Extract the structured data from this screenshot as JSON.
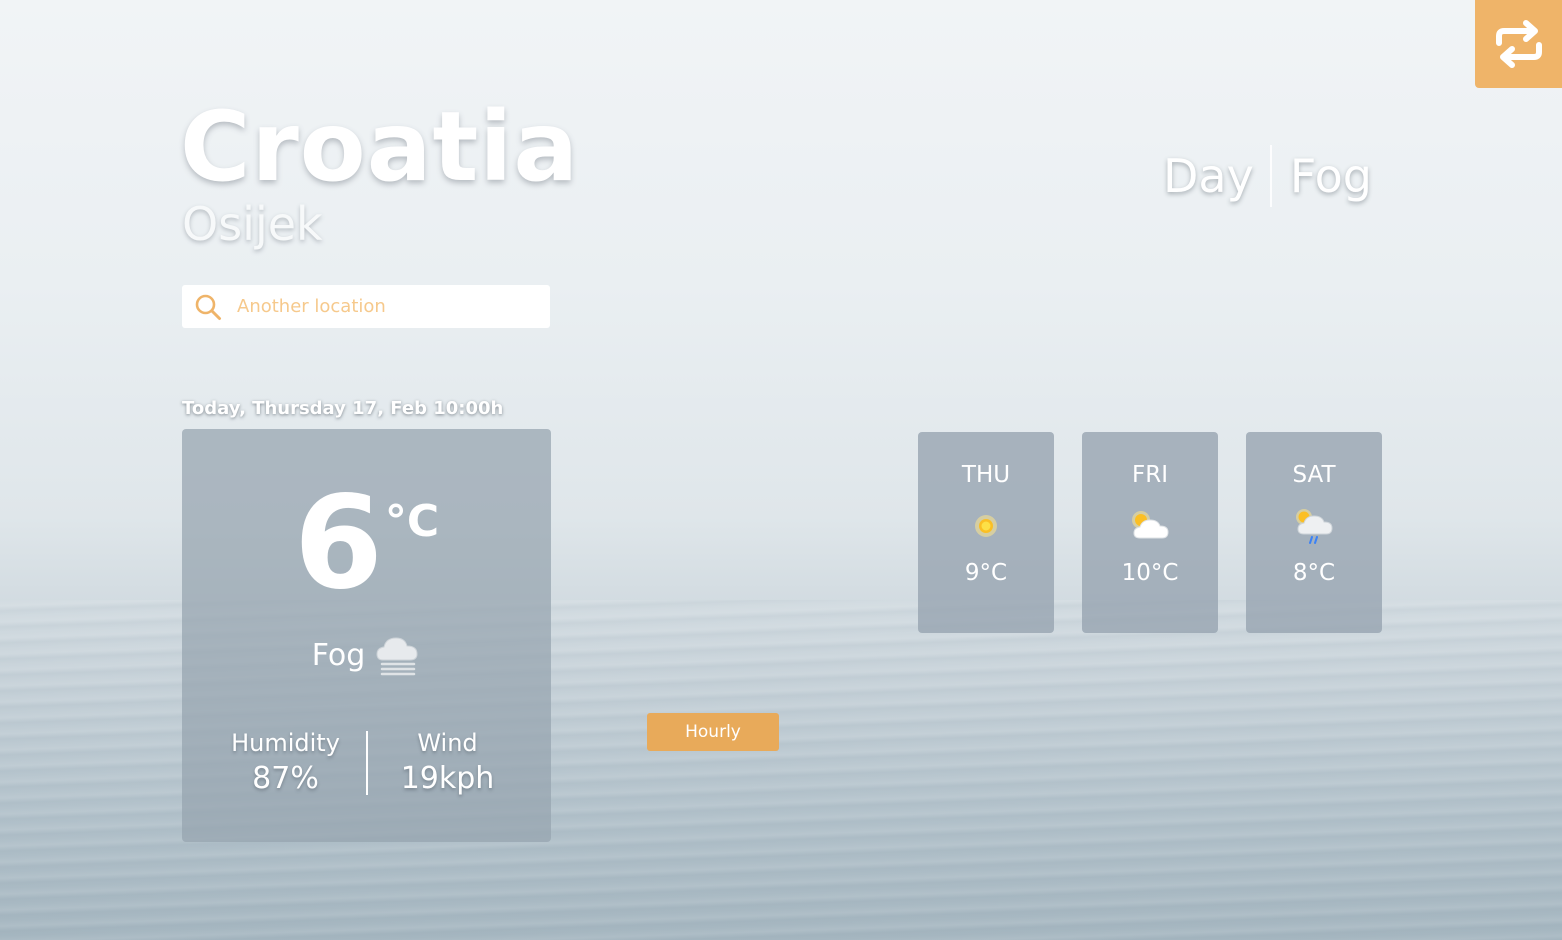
{
  "location": {
    "country": "Croatia",
    "city": "Osijek"
  },
  "search": {
    "placeholder": "Another location",
    "icon": "search-icon"
  },
  "status": {
    "period": "Day",
    "condition": "Fog"
  },
  "toggle": {
    "icon": "swap-arrows-icon",
    "color": "#efb469"
  },
  "current": {
    "date_label": "Today, Thursday 17, Feb 10:00h",
    "temperature": "6",
    "unit": "°C",
    "condition": "Fog",
    "condition_icon": "fog-icon",
    "humidity_label": "Humidity",
    "humidity_value": "87%",
    "wind_label": "Wind",
    "wind_value": "19kph"
  },
  "hourly_button": {
    "label": "Hourly",
    "color": "#e8aa5a"
  },
  "forecast": [
    {
      "day": "THU",
      "temp": "9°C",
      "icon": "sun-icon"
    },
    {
      "day": "FRI",
      "temp": "10°C",
      "icon": "partly-cloudy-icon"
    },
    {
      "day": "SAT",
      "temp": "8°C",
      "icon": "rain-cloud-icon"
    }
  ]
}
